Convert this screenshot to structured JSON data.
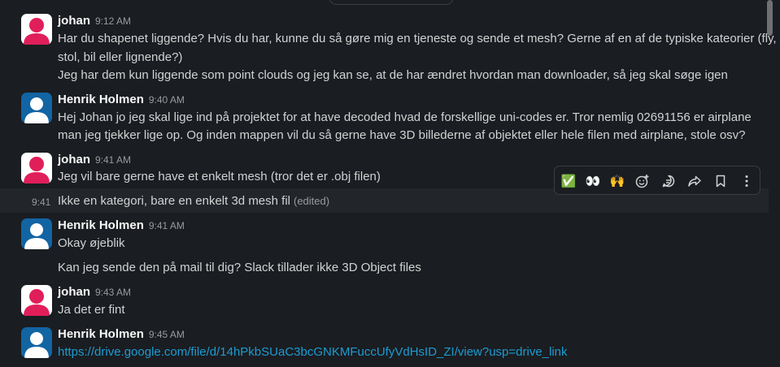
{
  "messages": [
    {
      "author": "johan",
      "time": "9:12 AM",
      "lines": [
        "Har du shapenet liggende? Hvis du har, kunne du så gøre mig en tjeneste og sende et mesh? Gerne af en af de typiske kateorier (fly,",
        "stol, bil eller lignende?)",
        "Jeg har dem kun liggende som point clouds og jeg kan se, at de har ændret hvordan man downloader, så jeg skal søge igen"
      ]
    },
    {
      "author": "Henrik Holmen",
      "time": "9:40 AM",
      "lines": [
        "Hej Johan jo jeg skal lige ind på projektet for at have decoded hvad de forskellige uni-codes er. Tror nemlig 02691156 er airplane",
        "man jeg tjekker lige op. Og inden mappen vil du så gerne have 3D billederne af objektet eller hele filen med airplane, stole osv?"
      ]
    },
    {
      "author": "johan",
      "time": "9:41 AM",
      "lines": [
        "Jeg vil bare gerne have et enkelt mesh (tror det er .obj filen)"
      ]
    },
    {
      "author": "Henrik Holmen",
      "time": "9:41 AM",
      "lines": [
        "Okay øjeblik"
      ]
    },
    {
      "author": "johan",
      "time": "9:43 AM",
      "lines": [
        "Ja det er fint"
      ]
    },
    {
      "author": "Henrik Holmen",
      "time": "9:45 AM",
      "link": "https://drive.google.com/file/d/14hPkbSUaC3bcGNKMFuccUfyVdHsID_ZI/view?usp=drive_link"
    }
  ],
  "continuation": {
    "time": "9:41",
    "text": "Ikke en kategori, bare en enkelt 3d mesh fil",
    "edited": "(edited)"
  },
  "continuation2": {
    "text": "Kan jeg sende den på mail til dig? Slack tillader ikke 3D Object files"
  },
  "toolbar": {
    "items": [
      "check-mark-reaction",
      "eyes-reaction",
      "raised-hands-reaction",
      "add-reaction",
      "reply-in-thread",
      "forward",
      "save",
      "more-actions"
    ],
    "check": "✅",
    "eyes": "👀",
    "hands": "🙌"
  },
  "colors": {
    "johan_avatar": "#e01e5a",
    "henrik_avatar": "#1264a3",
    "link": "#1d9bd1"
  }
}
